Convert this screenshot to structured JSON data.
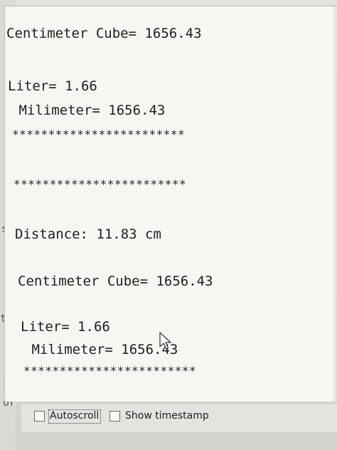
{
  "serial_output": {
    "lines": [
      "Centimeter Cube= 1656.43",
      "Liter= 1.66",
      " Milimeter= 1656.43",
      "************************",
      "************************",
      "Distance: 11.83 cm",
      "Centimeter Cube= 1656.43",
      "Liter= 1.66",
      " Milimeter= 1656.43",
      "************************"
    ]
  },
  "left_fragments": [
    "s",
    "tr",
    "so",
    "or"
  ],
  "controls": {
    "autoscroll_label": "Autoscroll",
    "autoscroll_checked": false,
    "timestamp_label": "Show timestamp",
    "timestamp_checked": false
  },
  "colors": {
    "output_background": "#f6f6f3",
    "text": "#1e1e1e",
    "window_frame": "#d9d9d6"
  },
  "icons": {
    "cursor": "mouse-pointer-icon"
  }
}
